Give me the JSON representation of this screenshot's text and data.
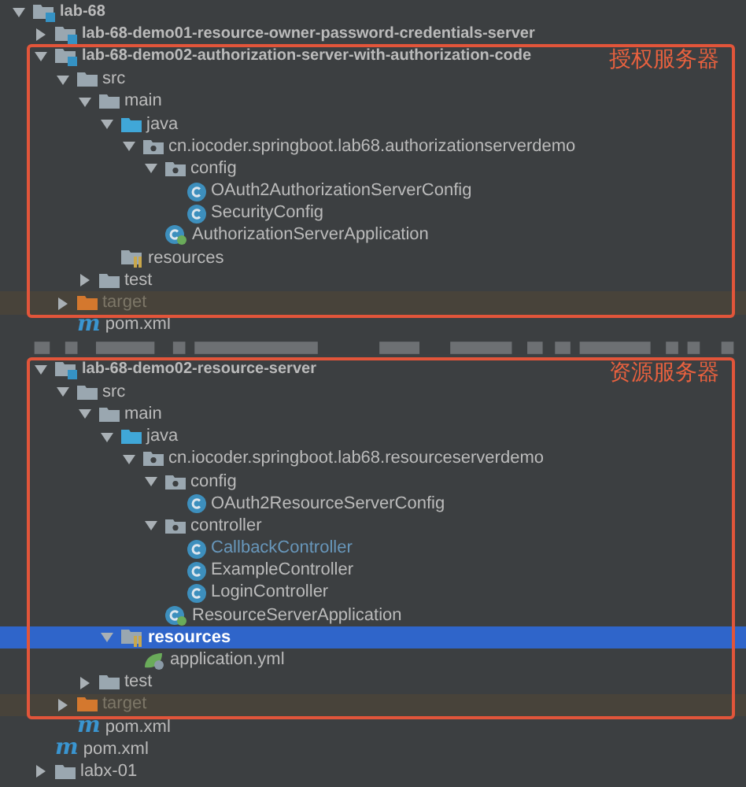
{
  "tree": [
    {
      "name": "lab-68",
      "kind": "module",
      "expanded": true,
      "selected": false,
      "children": [
        {
          "name": "lab-68-demo01-resource-owner-password-credentials-server",
          "kind": "module",
          "expanded": false,
          "selected": false
        },
        {
          "name": "lab-68-demo02-authorization-server-with-authorization-code",
          "kind": "module",
          "expanded": true,
          "selected": false,
          "annotation": "授权服务器",
          "children": [
            {
              "name": "src",
              "kind": "folder",
              "expanded": true,
              "selected": false,
              "children": [
                {
                  "name": "main",
                  "kind": "folder",
                  "expanded": true,
                  "selected": false,
                  "children": [
                    {
                      "name": "java",
                      "kind": "source_folder",
                      "expanded": true,
                      "selected": false,
                      "children": [
                        {
                          "name": "cn.iocoder.springboot.lab68.authorizationserverdemo",
                          "kind": "package",
                          "expanded": true,
                          "selected": false,
                          "children": [
                            {
                              "name": "config",
                              "kind": "package",
                              "expanded": true,
                              "selected": false,
                              "children": [
                                {
                                  "name": "OAuth2AuthorizationServerConfig",
                                  "kind": "class",
                                  "changed": false,
                                  "selected": false
                                },
                                {
                                  "name": "SecurityConfig",
                                  "kind": "class",
                                  "changed": false,
                                  "selected": false
                                }
                              ]
                            },
                            {
                              "name": "AuthorizationServerApplication",
                              "kind": "app",
                              "selected": false
                            }
                          ]
                        }
                      ]
                    },
                    {
                      "name": "resources",
                      "kind": "resources",
                      "selected": false
                    }
                  ]
                },
                {
                  "name": "test",
                  "kind": "folder",
                  "expanded": false,
                  "selected": false
                }
              ]
            },
            {
              "name": "target",
              "kind": "excluded",
              "expanded": false,
              "selected": false
            },
            {
              "name": "pom.xml",
              "kind": "maven",
              "icon_char": "m",
              "selected": false
            }
          ]
        },
        {
          "kind": "blurred",
          "selected": false
        },
        {
          "name": "lab-68-demo02-resource-server",
          "kind": "module",
          "expanded": true,
          "selected": false,
          "annotation": "资源服务器",
          "children": [
            {
              "name": "src",
              "kind": "folder",
              "expanded": true,
              "selected": false,
              "children": [
                {
                  "name": "main",
                  "kind": "folder",
                  "expanded": true,
                  "selected": false,
                  "children": [
                    {
                      "name": "java",
                      "kind": "source_folder",
                      "expanded": true,
                      "selected": false,
                      "children": [
                        {
                          "name": "cn.iocoder.springboot.lab68.resourceserverdemo",
                          "kind": "package",
                          "expanded": true,
                          "selected": false,
                          "children": [
                            {
                              "name": "config",
                              "kind": "package",
                              "expanded": true,
                              "selected": false,
                              "children": [
                                {
                                  "name": "OAuth2ResourceServerConfig",
                                  "kind": "class",
                                  "changed": false,
                                  "selected": false
                                }
                              ]
                            },
                            {
                              "name": "controller",
                              "kind": "package",
                              "expanded": true,
                              "selected": false,
                              "children": [
                                {
                                  "name": "CallbackController",
                                  "kind": "class",
                                  "changed": true,
                                  "selected": false
                                },
                                {
                                  "name": "ExampleController",
                                  "kind": "class",
                                  "changed": false,
                                  "selected": false
                                },
                                {
                                  "name": "LoginController",
                                  "kind": "class",
                                  "changed": false,
                                  "selected": false
                                }
                              ]
                            },
                            {
                              "name": "ResourceServerApplication",
                              "kind": "app",
                              "selected": false
                            }
                          ]
                        }
                      ]
                    },
                    {
                      "name": "resources",
                      "kind": "resources",
                      "expanded": true,
                      "selected": true,
                      "children": [
                        {
                          "name": "application.yml",
                          "kind": "yaml",
                          "selected": false
                        }
                      ]
                    }
                  ]
                },
                {
                  "name": "test",
                  "kind": "folder",
                  "expanded": false,
                  "selected": false
                }
              ]
            },
            {
              "name": "target",
              "kind": "excluded",
              "expanded": false,
              "selected": false
            },
            {
              "name": "pom.xml",
              "kind": "maven",
              "icon_char": "m",
              "selected": false
            }
          ]
        },
        {
          "name": "pom.xml",
          "kind": "maven",
          "icon_char": "m",
          "selected": false
        },
        {
          "name": "labx-01",
          "kind": "folder",
          "expanded": false,
          "selected": false
        }
      ]
    }
  ]
}
